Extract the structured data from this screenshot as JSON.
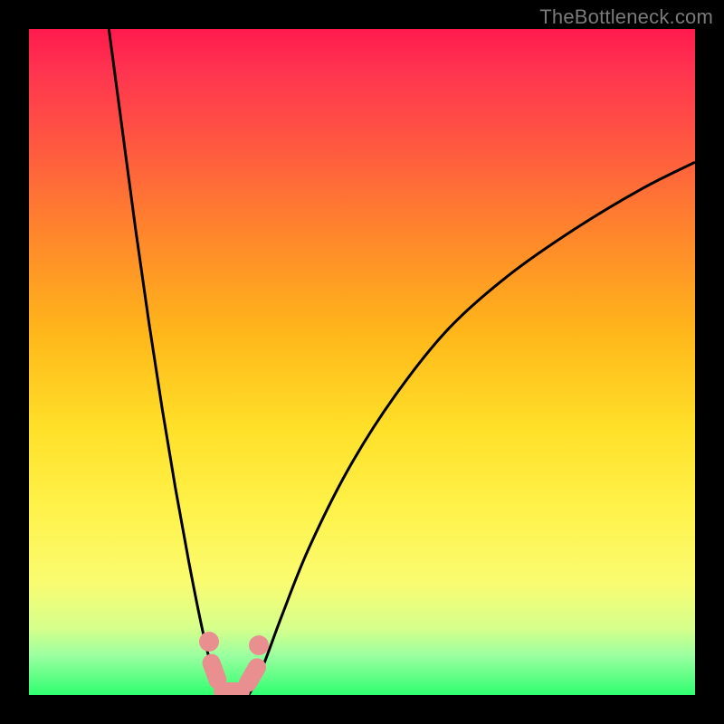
{
  "watermark": "TheBottleneck.com",
  "colors": {
    "gradient_top": "#ff1a4d",
    "gradient_bottom": "#2fff70",
    "curve": "#000000",
    "marker": "#ea8f8f",
    "frame": "#000000"
  },
  "chart_data": {
    "type": "line",
    "title": "",
    "xlabel": "",
    "ylabel": "",
    "xlim": [
      0,
      100
    ],
    "ylim": [
      0,
      100
    ],
    "series": [
      {
        "name": "left_branch",
        "x": [
          12,
          14,
          16,
          18,
          20,
          22,
          24,
          26,
          27.5,
          29,
          30
        ],
        "y": [
          100,
          85,
          70,
          56,
          43,
          31,
          20,
          10,
          4,
          1,
          0
        ]
      },
      {
        "name": "right_branch",
        "x": [
          33,
          35,
          38,
          42,
          48,
          55,
          63,
          72,
          82,
          92,
          100
        ],
        "y": [
          0,
          4,
          12,
          22,
          34,
          45,
          55,
          63,
          70,
          76,
          80
        ]
      }
    ],
    "markers": [
      {
        "name": "left_dot_top",
        "x": 27.0,
        "y": 8.0,
        "shape": "dot"
      },
      {
        "name": "left_bar",
        "x": 27.8,
        "y": 3.5,
        "shape": "bar",
        "angle": 70
      },
      {
        "name": "bottom_bar",
        "x": 30.5,
        "y": 0.5,
        "shape": "bar",
        "angle": 0
      },
      {
        "name": "right_bar",
        "x": 33.5,
        "y": 3.0,
        "shape": "bar",
        "angle": -60
      },
      {
        "name": "right_dot_top",
        "x": 34.5,
        "y": 7.5,
        "shape": "dot"
      }
    ],
    "background": {
      "type": "vertical_gradient",
      "stops": [
        {
          "pos": 0,
          "color": "#ff1a4d"
        },
        {
          "pos": 50,
          "color": "#ffd52a"
        },
        {
          "pos": 100,
          "color": "#2fff70"
        }
      ]
    }
  }
}
